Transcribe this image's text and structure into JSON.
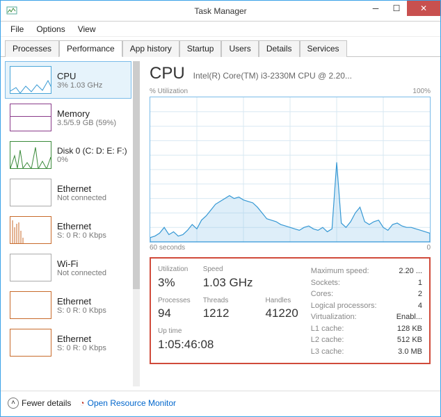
{
  "window": {
    "title": "Task Manager"
  },
  "menu": {
    "file": "File",
    "options": "Options",
    "view": "View"
  },
  "tabs": {
    "processes": "Processes",
    "performance": "Performance",
    "app_history": "App history",
    "startup": "Startup",
    "users": "Users",
    "details": "Details",
    "services": "Services"
  },
  "sidebar": {
    "items": [
      {
        "title": "CPU",
        "sub": "3% 1.03 GHz"
      },
      {
        "title": "Memory",
        "sub": "3.5/5.9 GB (59%)"
      },
      {
        "title": "Disk 0 (C: D: E: F:)",
        "sub": "0%"
      },
      {
        "title": "Ethernet",
        "sub": "Not connected"
      },
      {
        "title": "Ethernet",
        "sub": "S: 0 R: 0 Kbps"
      },
      {
        "title": "Wi-Fi",
        "sub": "Not connected"
      },
      {
        "title": "Ethernet",
        "sub": "S: 0 R: 0 Kbps"
      },
      {
        "title": "Ethernet",
        "sub": "S: 0 R: 0 Kbps"
      }
    ]
  },
  "main": {
    "title": "CPU",
    "model": "Intel(R) Core(TM) i3-2330M CPU @ 2.20...",
    "chart_top_left": "% Utilization",
    "chart_top_right": "100%",
    "chart_bottom_left": "60 seconds",
    "chart_bottom_right": "0"
  },
  "stats": {
    "labels": {
      "utilization": "Utilization",
      "speed": "Speed",
      "processes": "Processes",
      "threads": "Threads",
      "handles": "Handles",
      "uptime": "Up time"
    },
    "values": {
      "utilization": "3%",
      "speed": "1.03 GHz",
      "processes": "94",
      "threads": "1212",
      "handles": "41220",
      "uptime": "1:05:46:08"
    },
    "right": [
      {
        "k": "Maximum speed:",
        "v": "2.20 ..."
      },
      {
        "k": "Sockets:",
        "v": "1"
      },
      {
        "k": "Cores:",
        "v": "2"
      },
      {
        "k": "Logical processors:",
        "v": "4"
      },
      {
        "k": "Virtualization:",
        "v": "Enabl..."
      },
      {
        "k": "L1 cache:",
        "v": "128 KB"
      },
      {
        "k": "L2 cache:",
        "v": "512 KB"
      },
      {
        "k": "L3 cache:",
        "v": "3.0 MB"
      }
    ]
  },
  "footer": {
    "fewer": "Fewer details",
    "resmon": "Open Resource Monitor"
  },
  "chart_data": {
    "type": "line",
    "title": "CPU % Utilization",
    "xlabel": "seconds",
    "ylabel": "% Utilization",
    "xlim": [
      0,
      60
    ],
    "ylim": [
      0,
      100
    ],
    "x": [
      0,
      1,
      2,
      3,
      4,
      5,
      6,
      7,
      8,
      9,
      10,
      11,
      12,
      13,
      14,
      15,
      16,
      17,
      18,
      19,
      20,
      21,
      22,
      23,
      24,
      25,
      26,
      27,
      28,
      29,
      30,
      31,
      32,
      33,
      34,
      35,
      36,
      37,
      38,
      39,
      40,
      41,
      42,
      43,
      44,
      45,
      46,
      47,
      48,
      49,
      50,
      51,
      52,
      53,
      54,
      55,
      56,
      57,
      58,
      59,
      60
    ],
    "values": [
      3,
      4,
      6,
      10,
      5,
      7,
      4,
      5,
      8,
      12,
      9,
      15,
      18,
      22,
      26,
      28,
      30,
      32,
      30,
      31,
      29,
      28,
      27,
      24,
      20,
      16,
      15,
      14,
      12,
      11,
      10,
      9,
      8,
      10,
      11,
      9,
      8,
      10,
      7,
      9,
      55,
      13,
      10,
      14,
      20,
      24,
      14,
      12,
      14,
      15,
      10,
      8,
      12,
      13,
      11,
      10,
      10,
      9,
      8,
      7,
      6
    ]
  }
}
